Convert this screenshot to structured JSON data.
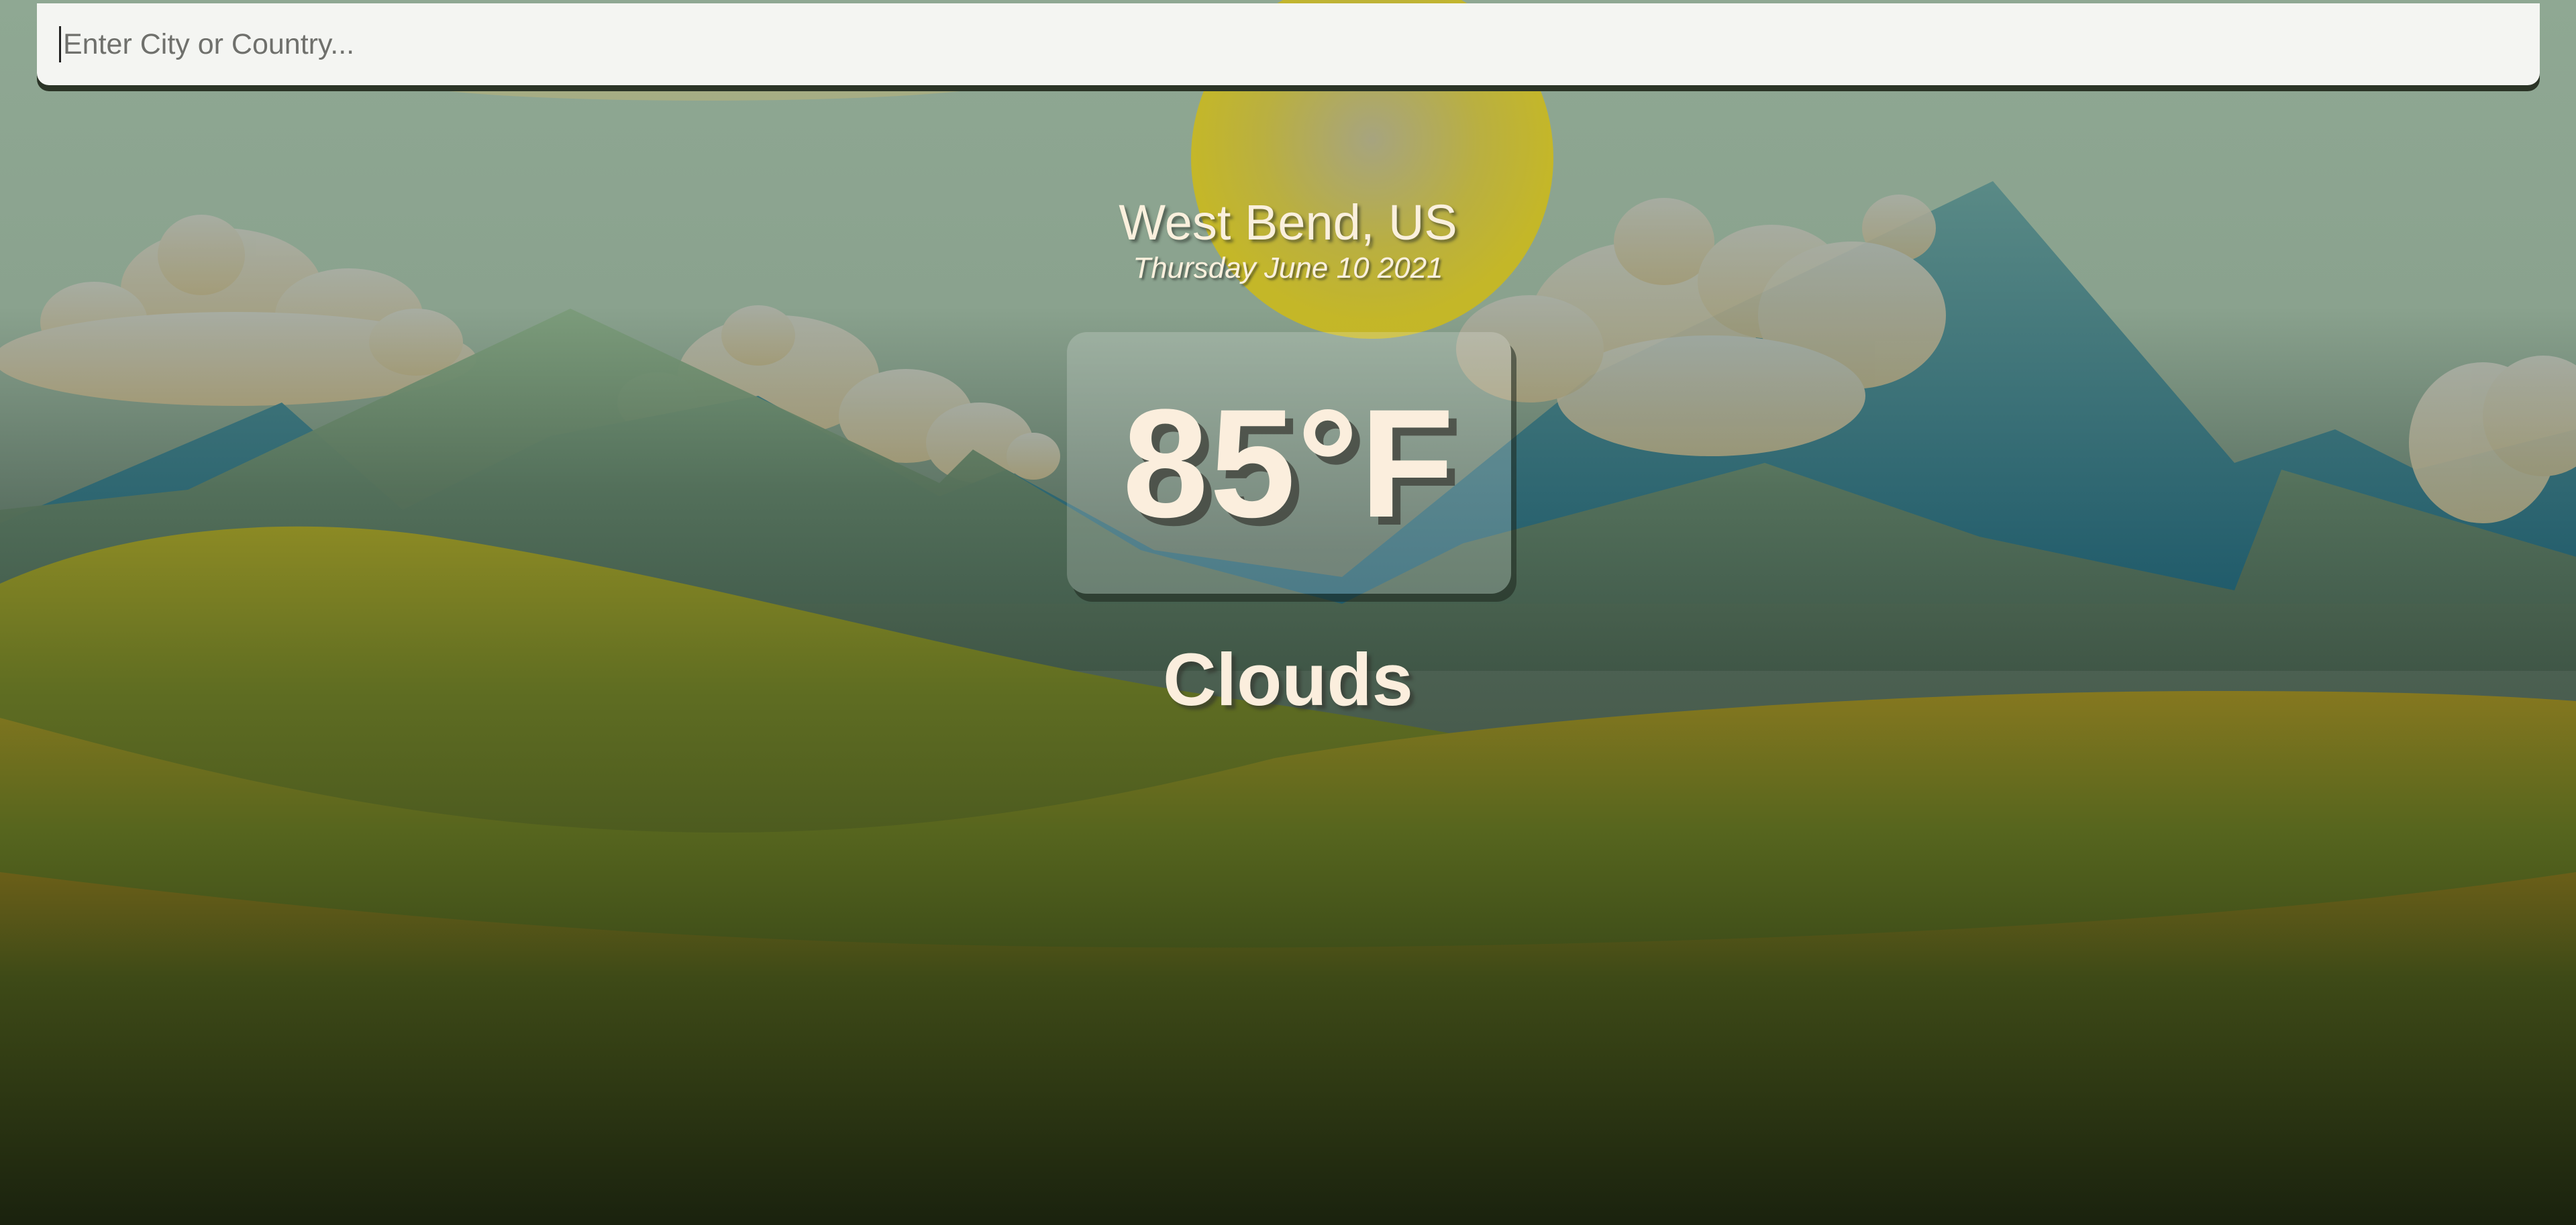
{
  "search": {
    "placeholder": "Enter City or Country...",
    "value": ""
  },
  "weather": {
    "location": "West Bend, US",
    "date": "Thursday June 10 2021",
    "temperature": "85°F",
    "condition": "Clouds"
  },
  "colors": {
    "text": "#faf0dd",
    "search_bg": "#f4f5f2",
    "sky_top": "#8fa894",
    "ground_bottom": "#1b2410",
    "sun": "#c4b62a"
  }
}
